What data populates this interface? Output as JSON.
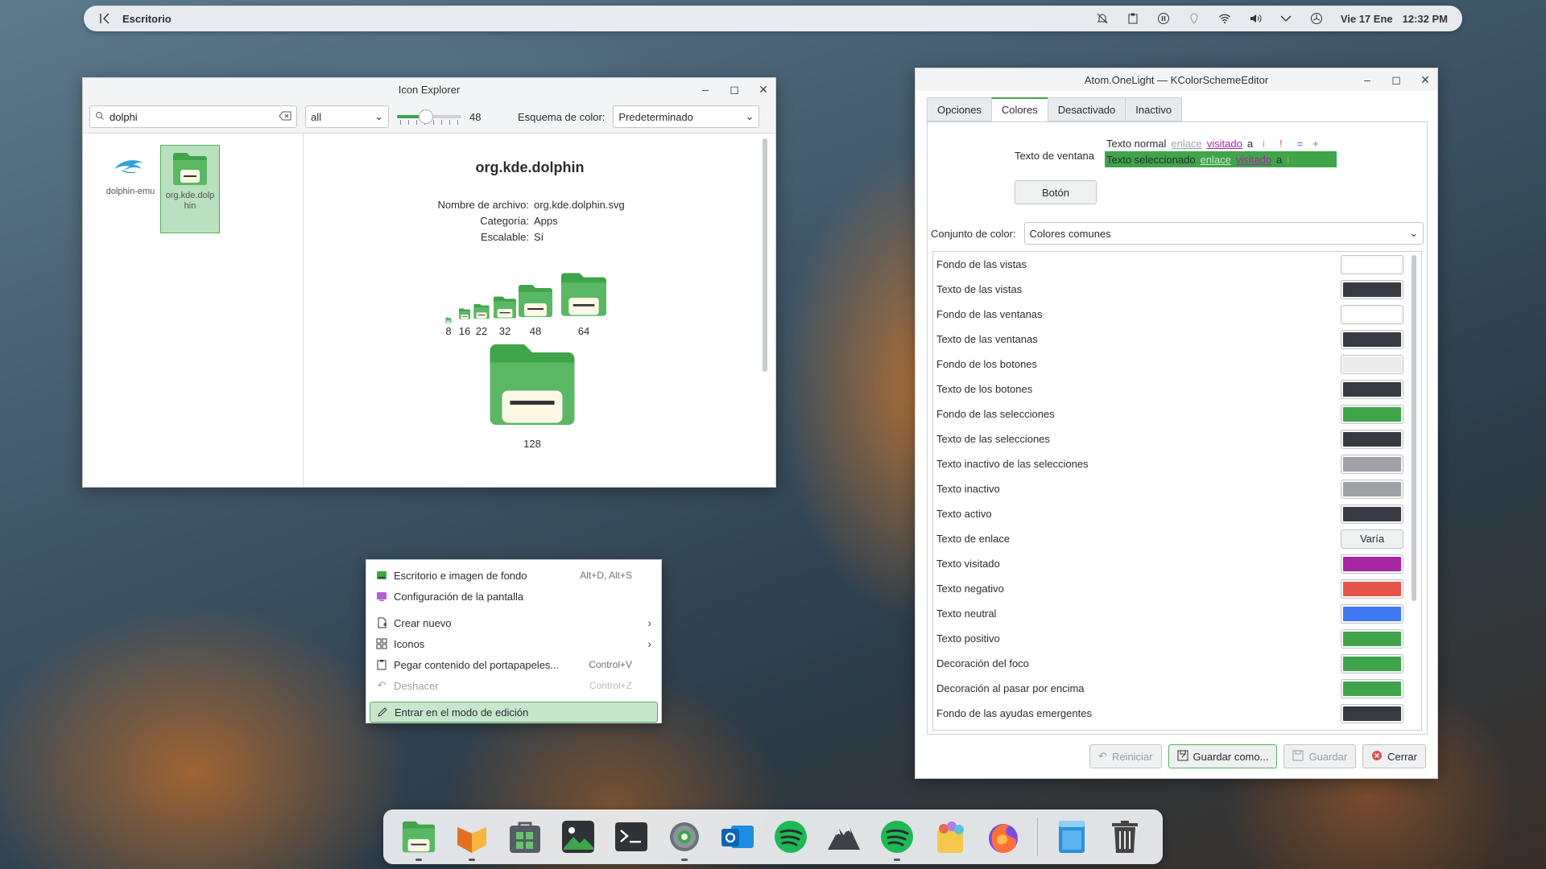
{
  "top_panel": {
    "title": "Escritorio",
    "date": "Vie 17 Ene",
    "time": "12:32 PM"
  },
  "icon_explorer": {
    "title": "Icon Explorer",
    "search_value": "dolphi",
    "filter_value": "all",
    "size_value": "48",
    "size_fraction": 0.45,
    "color_scheme_label": "Esquema de color:",
    "color_scheme_value": "Predeterminado",
    "items": [
      {
        "label": "dolphin-emu"
      },
      {
        "label": "org.kde.dolp hin"
      }
    ],
    "detail": {
      "name": "org.kde.dolphin",
      "props": [
        {
          "key": "Nombre de archivo:",
          "value": "org.kde.dolphin.svg"
        },
        {
          "key": "Categoría:",
          "value": "Apps"
        },
        {
          "key": "Escalable:",
          "value": "Sí"
        }
      ],
      "sizes": [
        "8",
        "16",
        "22",
        "32",
        "48",
        "64"
      ],
      "big_size": "128"
    }
  },
  "kcse": {
    "title": "Atom.OneLight — KColorSchemeEditor",
    "tabs": [
      "Opciones",
      "Colores",
      "Desactivado",
      "Inactivo"
    ],
    "preview": {
      "label": "Texto de ventana",
      "normal": "Texto normal",
      "selected": "Texto seleccionado",
      "link": "enlace",
      "visited": "visitado",
      "a": "a",
      "i": "i",
      "bang": "!",
      "eq": "=",
      "plus": "+",
      "button": "Botón"
    },
    "set_label": "Conjunto de color:",
    "set_value": "Colores comunes",
    "colors": [
      {
        "name": "Fondo de las vistas",
        "color": "#ffffff"
      },
      {
        "name": "Texto de las vistas",
        "color": "#383a42"
      },
      {
        "name": "Fondo de las ventanas",
        "color": "#ffffff"
      },
      {
        "name": "Texto de las ventanas",
        "color": "#383a42"
      },
      {
        "name": "Fondo de los botones",
        "color": "#eaeaeb"
      },
      {
        "name": "Texto de los botones",
        "color": "#383a42"
      },
      {
        "name": "Fondo de las selecciones",
        "color": "#3fa44a"
      },
      {
        "name": "Texto de las selecciones",
        "color": "#383a42"
      },
      {
        "name": "Texto inactivo de las selecciones",
        "color": "#a0a1a7"
      },
      {
        "name": "Texto inactivo",
        "color": "#a0a1a7"
      },
      {
        "name": "Texto activo",
        "color": "#383a42"
      },
      {
        "name": "Texto de enlace",
        "color": "",
        "text": "Varía"
      },
      {
        "name": "Texto visitado",
        "color": "#a626a4"
      },
      {
        "name": "Texto negativo",
        "color": "#e45649"
      },
      {
        "name": "Texto neutral",
        "color": "#4078f2"
      },
      {
        "name": "Texto positivo",
        "color": "#3fa44a"
      },
      {
        "name": "Decoración del foco",
        "color": "#3fa44a"
      },
      {
        "name": "Decoración al pasar por encima",
        "color": "#3fa44a"
      },
      {
        "name": "Fondo de las ayudas emergentes",
        "color": "#383a42"
      }
    ],
    "buttons": {
      "reset": "Reiniciar",
      "save_as": "Guardar como...",
      "save": "Guardar",
      "close": "Cerrar"
    }
  },
  "context_menu": {
    "items": [
      {
        "label": "Escritorio e imagen de fondo",
        "shortcut": "Alt+D, Alt+S"
      },
      {
        "label": "Configuración de la pantalla",
        "shortcut": ""
      },
      {
        "label": "Crear nuevo",
        "shortcut": ""
      },
      {
        "label": "Iconos",
        "shortcut": ""
      },
      {
        "label": "Pegar contenido del portapapeles...",
        "shortcut": "Control+V"
      },
      {
        "label": "Deshacer",
        "shortcut": "Control+Z"
      },
      {
        "label": "Entrar en el modo de edición",
        "shortcut": ""
      }
    ]
  },
  "colors": {
    "accent": "#3fa44a",
    "panel": "#e7eaee",
    "dock": "#eef0f3"
  }
}
